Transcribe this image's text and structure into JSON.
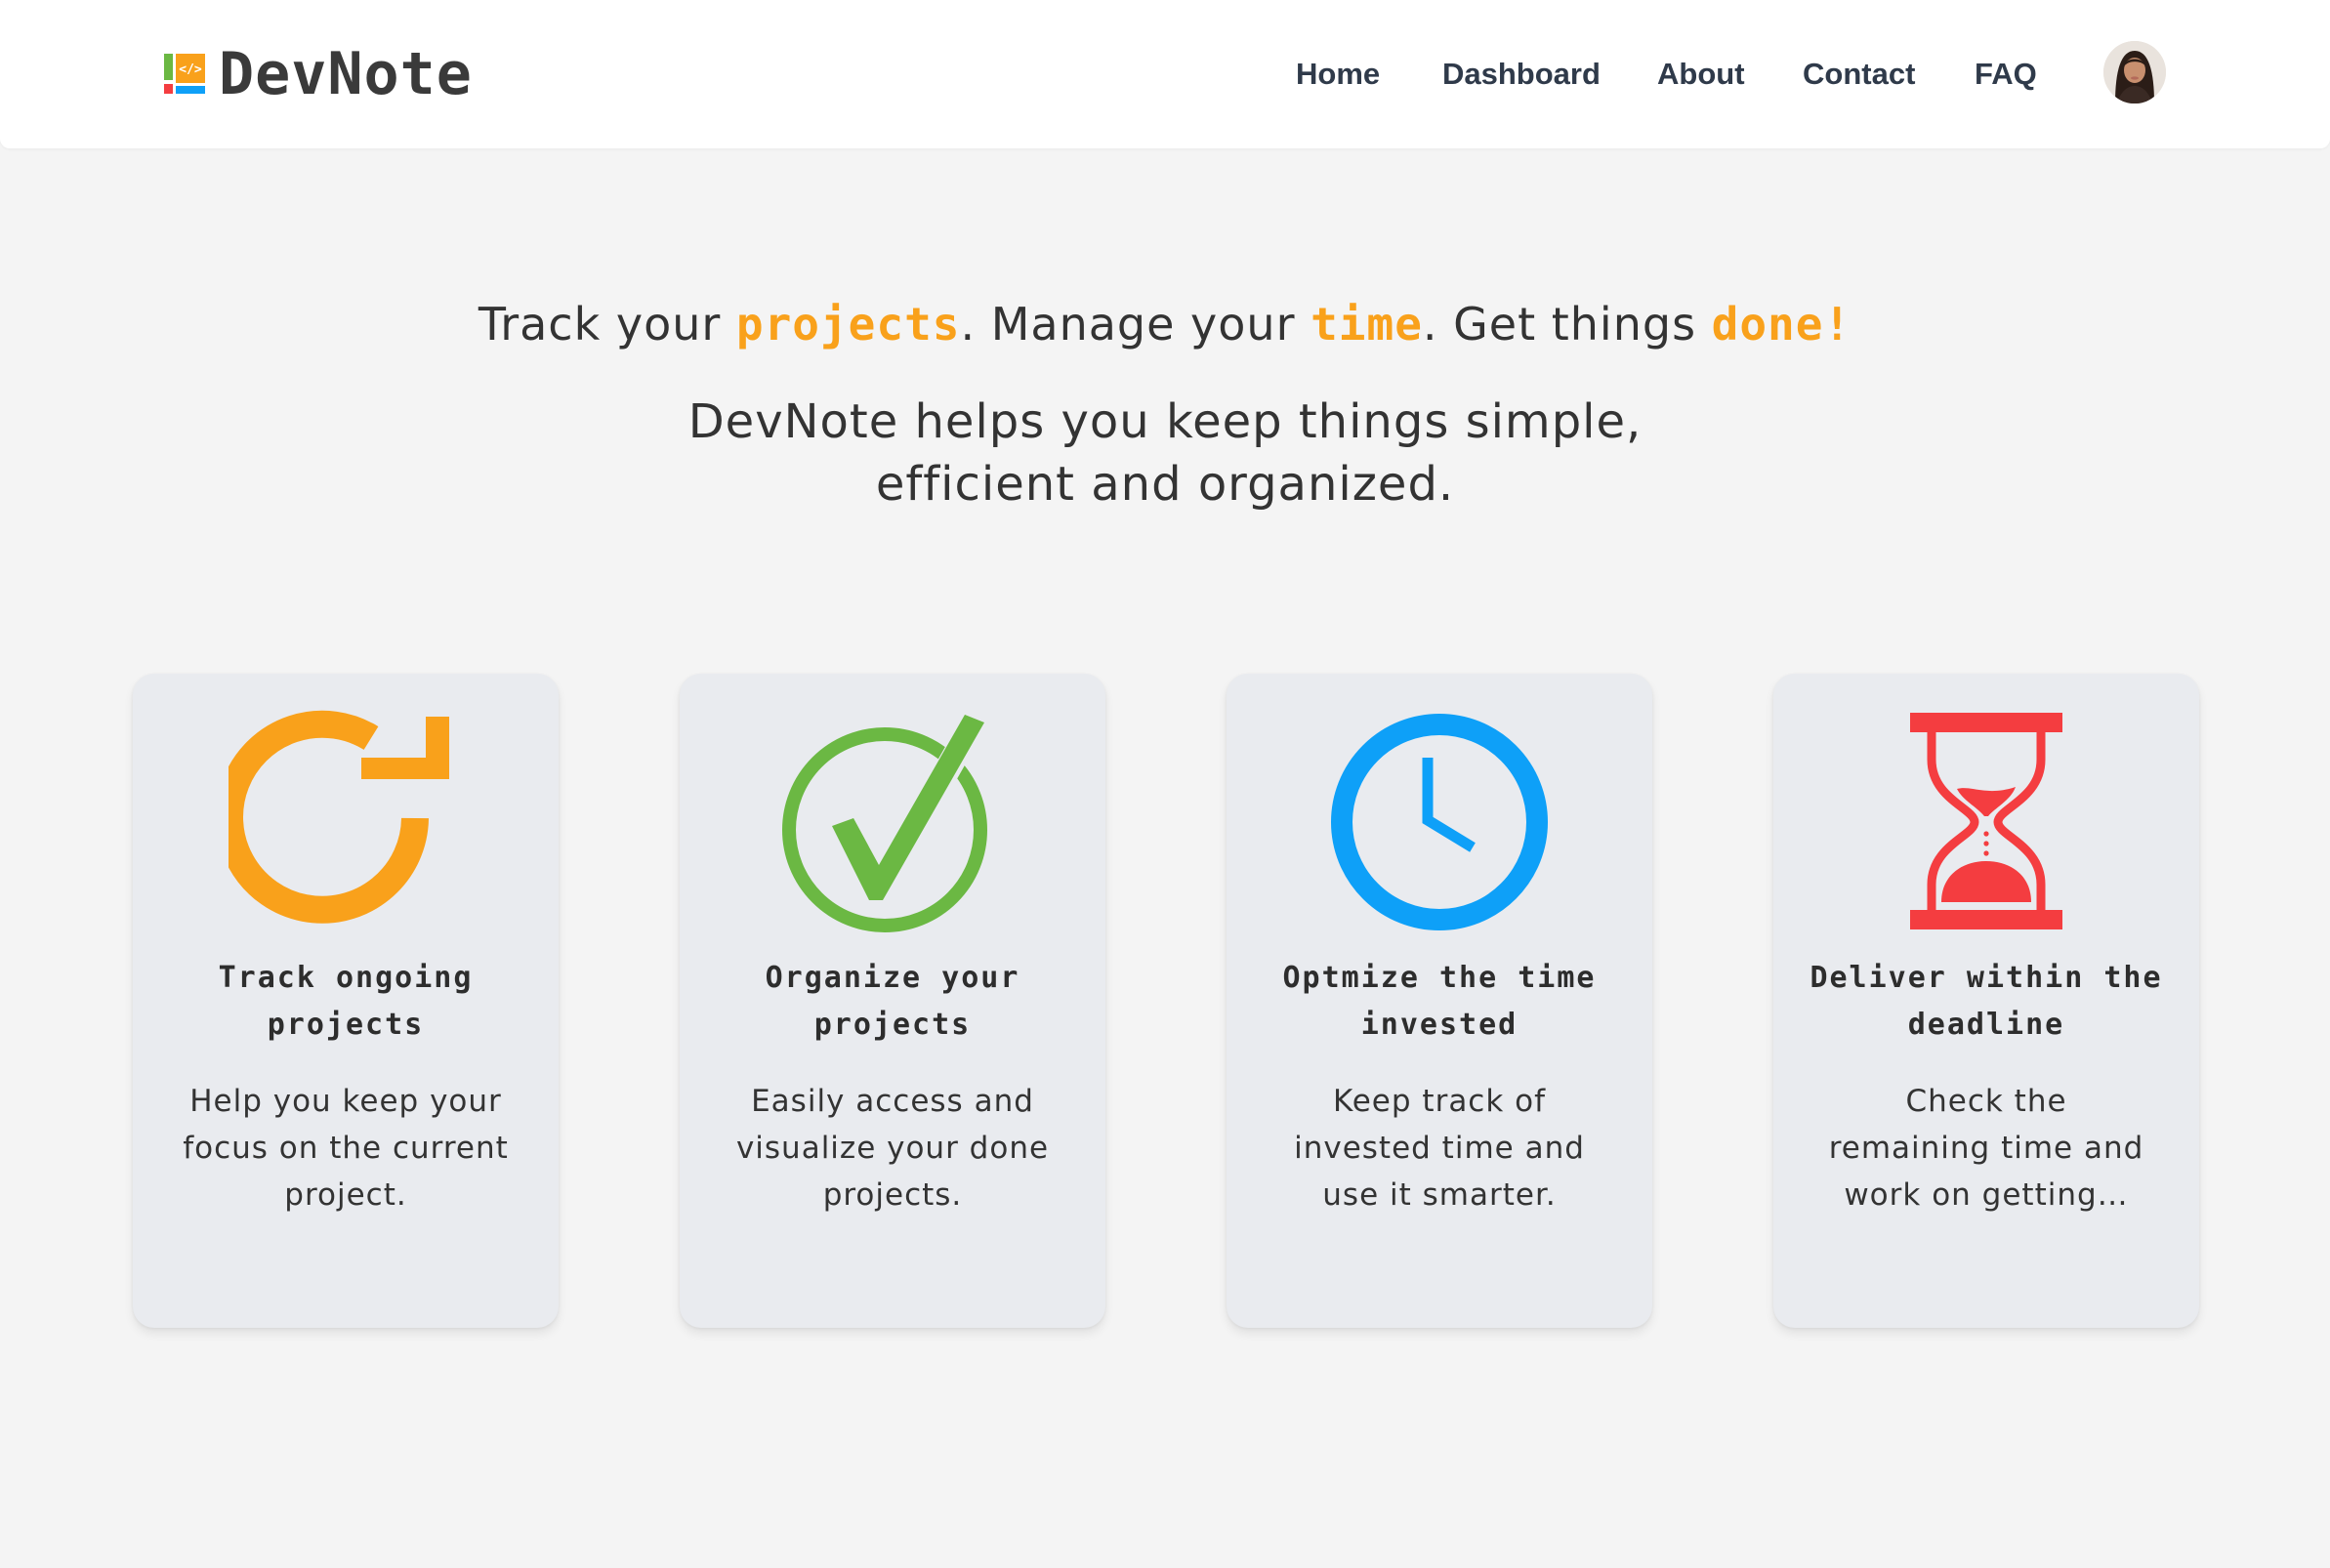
{
  "header": {
    "logo_text": "DevNote",
    "nav": [
      {
        "label": "Home"
      },
      {
        "label": "Dashboard"
      },
      {
        "label": "About"
      },
      {
        "label": "Contact"
      },
      {
        "label": "FAQ"
      }
    ]
  },
  "hero": {
    "tagline_parts": [
      "Track your ",
      "projects",
      ". Manage your ",
      "time",
      ". Get things ",
      "done!"
    ],
    "subtitle_lines": [
      "DevNote helps you keep things simple,",
      "efficient and organized."
    ]
  },
  "features": [
    {
      "icon": "refresh-icon",
      "title_lines": [
        "Track ongoing",
        "projects"
      ],
      "desc_lines": [
        "Help you keep your",
        "focus on the current",
        "project."
      ]
    },
    {
      "icon": "check-circle-icon",
      "title_lines": [
        "Organize your",
        "projects"
      ],
      "desc_lines": [
        "Easily access and",
        "visualize your done",
        "projects."
      ]
    },
    {
      "icon": "clock-icon",
      "title_lines": [
        "Optmize the time",
        "invested"
      ],
      "desc_lines": [
        "Keep track of",
        "invested time and",
        "use it smarter."
      ]
    },
    {
      "icon": "hourglass-icon",
      "title_lines": [
        "Deliver within the",
        "deadline"
      ],
      "desc_lines": [
        "Check the",
        "remaining time and",
        "work on getting…"
      ]
    }
  ],
  "colors": {
    "accent": "#f9a11b",
    "green": "#6bb843",
    "blue": "#0ea0f8",
    "red": "#f43d40"
  }
}
